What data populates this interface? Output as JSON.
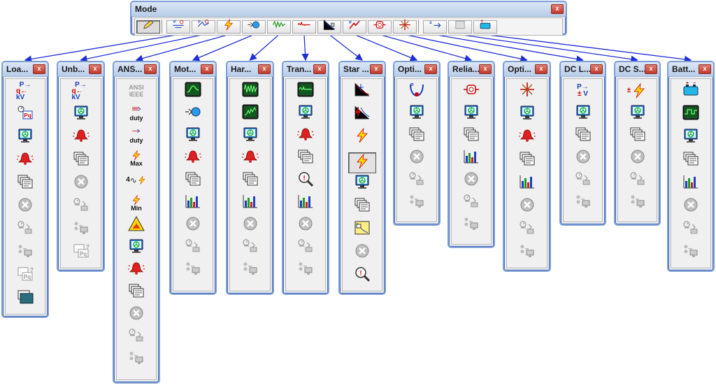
{
  "mode_toolbar": {
    "title": "Mode",
    "close": "x",
    "buttons": [
      "edit-pencil-icon",
      "load-flow-icon",
      "unbalanced-load-flow-icon",
      "short-circuit-icon",
      "motor-starting-icon",
      "harmonic-icon",
      "transient-icon",
      "star-protection-icon",
      "optimal-power-flow-icon",
      "reliability-icon",
      "optimal-capacitor-icon",
      "dc-load-flow-icon",
      "dc-short-circuit-icon",
      "battery-sizing-icon"
    ]
  },
  "panels": [
    {
      "title": "Loa...",
      "icons": [
        "pkv-lf-icon",
        "meter-pq-icon",
        "study-case-icon",
        "alarm-bell-icon",
        "report-pages-icon",
        "halt-icon",
        "get-online-icon",
        "online-pc-icon",
        "pq-report-icon",
        "output-report-icon"
      ]
    },
    {
      "title": "Unb...",
      "icons": [
        "pkv-lf-icon",
        "study-case-icon",
        "alarm-bell-icon",
        "report-pages-icon",
        "halt-icon",
        "get-online-icon",
        "online-pc-icon",
        "pq-report-icon"
      ]
    },
    {
      "title": "ANS...",
      "ansi_label": "ANSI",
      "ieee_label": "IEEE",
      "duty_label": "duty",
      "max_label": "Max",
      "four_label": "4",
      "min_label": "Min",
      "icons": [
        "ansi-ieee-icon",
        "duty-3phase-icon",
        "duty-1phase-icon",
        "max-icon",
        "four-cycle-icon",
        "min-icon",
        "arc-flash-icon",
        "study-case-icon",
        "alarm-bell-icon",
        "report-pages-icon",
        "halt-icon",
        "get-online-icon",
        "online-pc-icon"
      ]
    },
    {
      "title": "Mot...",
      "icons": [
        "motor-plot-icon",
        "motor-starting-icon",
        "study-case-icon",
        "alarm-bell-icon",
        "report-pages-icon",
        "bar-chart-icon",
        "halt-icon",
        "get-online-icon",
        "online-pc-icon"
      ]
    },
    {
      "title": "Har...",
      "icons": [
        "harmonic-plot-icon",
        "harmonic-spectrum-icon",
        "study-case-icon",
        "alarm-bell-icon",
        "report-pages-icon",
        "bar-chart-icon",
        "halt-icon",
        "get-online-icon",
        "online-pc-icon"
      ]
    },
    {
      "title": "Tran...",
      "icons": [
        "transient-plot-icon",
        "study-case-icon",
        "alarm-bell-icon",
        "report-pages-icon",
        "magnifier-alert-icon",
        "bar-chart-icon",
        "halt-icon",
        "get-online-icon",
        "online-pc-icon"
      ]
    },
    {
      "title": "Star ...",
      "icons": [
        "star-coord-icon",
        "star-relay-icon",
        "star-fault-icon",
        "star-fault-selected-icon",
        "study-case-icon",
        "report-pages-icon",
        "star-view-icon",
        "halt-icon",
        "magnifier-alert-icon"
      ]
    },
    {
      "title": "Opti...",
      "icons": [
        "opf-icon",
        "study-case-icon",
        "report-pages-icon",
        "halt-icon",
        "get-online-icon",
        "online-pc-icon"
      ]
    },
    {
      "title": "Relia...",
      "icons": [
        "reliability-icon",
        "study-case-icon",
        "report-pages-icon",
        "bar-chart-icon",
        "halt-icon",
        "get-online-icon",
        "online-pc-icon"
      ]
    },
    {
      "title": "Opti...",
      "icons": [
        "optimal-capacitor-icon",
        "study-case-icon",
        "alarm-bell-icon",
        "report-pages-icon",
        "bar-chart-icon",
        "halt-icon",
        "get-online-icon",
        "online-pc-icon"
      ]
    },
    {
      "title": "DC L...",
      "icons": [
        "dc-lf-icon",
        "study-case-icon",
        "report-pages-icon",
        "halt-icon",
        "get-online-icon",
        "online-pc-icon"
      ]
    },
    {
      "title": "DC S...",
      "icons": [
        "dc-sc-icon",
        "study-case-icon",
        "report-pages-icon",
        "halt-icon",
        "get-online-icon",
        "online-pc-icon"
      ]
    },
    {
      "title": "Batt...",
      "icons": [
        "battery-icon",
        "battery-plot-icon",
        "study-case-icon",
        "report-pages-icon",
        "bar-chart-icon",
        "halt-icon",
        "get-online-icon",
        "online-pc-icon"
      ]
    }
  ],
  "labels": {
    "p": "P",
    "kv": "kV",
    "q": "q",
    "v": "V",
    "pm": "±",
    "pq": "Pq",
    "qmark": "?"
  }
}
